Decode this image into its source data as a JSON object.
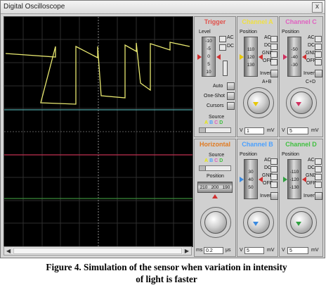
{
  "window": {
    "title": "Digital Oscilloscope",
    "close_glyph": "x"
  },
  "trigger": {
    "title": "Trigger",
    "title_color": "#e0504a",
    "level_label": "Level",
    "level_scale": [
      "-10",
      "-5",
      "0",
      "5",
      "10"
    ],
    "coupling_ac": "AC",
    "coupling_dc": "DC",
    "auto_label": "Auto",
    "one_shot_label": "One-Shot",
    "cursors_label": "Cursors",
    "source_label": "Source",
    "source_options": [
      "A",
      "B",
      "C",
      "D"
    ],
    "source_colors": [
      "#e8e800",
      "#4aa0ff",
      "#e060c0",
      "#40c040"
    ]
  },
  "channel_a": {
    "title": "Channel A",
    "title_color": "#f0e040",
    "position_label": "Position",
    "scale": [
      "110",
      "120",
      "130"
    ],
    "coupling": [
      "AC",
      "DC",
      "GND",
      "OFF"
    ],
    "invert_label": "Invert",
    "aplusb_label": "A+B",
    "value": "1",
    "unit_left": "V",
    "unit_right": "mV",
    "marker_color": "#e8c800"
  },
  "channel_c": {
    "title": "Channel C",
    "title_color": "#e060c0",
    "position_label": "Position",
    "scale": [
      "-50",
      "-40",
      "-30"
    ],
    "coupling": [
      "AC",
      "DC",
      "GND",
      "OFF"
    ],
    "invert_label": "Invert",
    "cplusd_label": "C+D",
    "value": "5",
    "unit_left": "V",
    "unit_right": "mV",
    "marker_color": "#d03060"
  },
  "horizontal": {
    "title": "Horizontal",
    "title_color": "#e07a20",
    "source_label": "Source",
    "source_options": [
      "A",
      "B",
      "C",
      "D"
    ],
    "source_colors": [
      "#e8e800",
      "#4aa0ff",
      "#e060c0",
      "#40c040"
    ],
    "position_label": "Position",
    "position_scale": [
      "210",
      "200",
      "190"
    ],
    "value": "0.2",
    "unit_left": "ms",
    "unit_right": "μs"
  },
  "channel_b": {
    "title": "Channel B",
    "title_color": "#4aa0ff",
    "position_label": "Position",
    "scale": [
      "30",
      "40",
      "50"
    ],
    "coupling": [
      "AC",
      "DC",
      "GND",
      "OFF"
    ],
    "invert_label": "Invert",
    "value": "5",
    "unit_left": "V",
    "unit_right": "mV",
    "marker_color": "#3a8ae0"
  },
  "channel_d": {
    "title": "Channel D",
    "title_color": "#40c040",
    "position_label": "Position",
    "scale": [
      "-110",
      "-120",
      "-130"
    ],
    "coupling": [
      "AC",
      "DC",
      "GND",
      "OFF"
    ],
    "invert_label": "Invert",
    "value": "5",
    "unit_left": "V",
    "unit_right": "mV",
    "marker_color": "#30a040"
  },
  "caption": {
    "line1": "Figure 4. Simulation of the sensor when variation in intensity",
    "line2": "of light is faster"
  }
}
